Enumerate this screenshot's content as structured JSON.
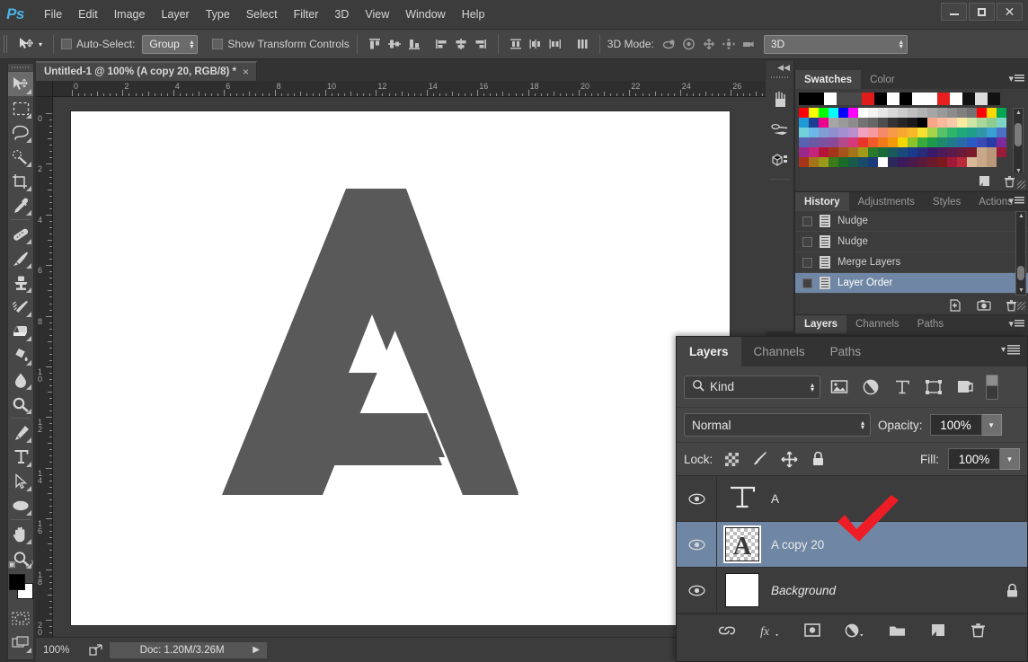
{
  "app": {
    "logo": "Ps",
    "menus": [
      "File",
      "Edit",
      "Image",
      "Layer",
      "Type",
      "Select",
      "Filter",
      "3D",
      "View",
      "Window",
      "Help"
    ],
    "window_controls": {
      "minimize": "minimize-icon",
      "maximize": "maximize-icon",
      "close": "close-icon"
    }
  },
  "options_bar": {
    "tool_icon": "move-tool-icon",
    "autoselect_label": "Auto-Select:",
    "autoselect_checked": false,
    "autoselect_value": "Group",
    "show_transform_label": "Show Transform Controls",
    "show_transform_checked": false,
    "align_icons": [
      "align-top-edges-icon",
      "align-vertical-centers-icon",
      "align-bottom-edges-icon",
      "align-left-edges-icon",
      "align-horizontal-centers-icon",
      "align-right-edges-icon"
    ],
    "distribute_icons": [
      "distribute-top-edges-icon",
      "distribute-vertical-centers-icon",
      "distribute-bottom-edges-icon",
      "distribute-left-edges-icon",
      "distribute-horizontal-centers-icon",
      "distribute-right-edges-icon"
    ],
    "auto_align_icon": "auto-align-layers-icon",
    "mode3d_label": "3D Mode:",
    "mode3d_icons": [
      "rotate-3d-icon",
      "roll-3d-icon",
      "pan-3d-icon",
      "slide-3d-icon",
      "scale-3d-icon"
    ],
    "mode3d_value": "3D"
  },
  "toolbar": {
    "tools": [
      {
        "name": "move-tool",
        "glyph": "move",
        "active": true
      },
      {
        "name": "rectangular-marquee-tool",
        "glyph": "marquee"
      },
      {
        "name": "lasso-tool",
        "glyph": "lasso"
      },
      {
        "name": "quick-selection-tool",
        "glyph": "quickselect"
      },
      {
        "name": "crop-tool",
        "glyph": "crop"
      },
      {
        "name": "eyedropper-tool",
        "glyph": "eyedropper"
      },
      {
        "name": "spot-healing-brush-tool",
        "glyph": "healing"
      },
      {
        "name": "brush-tool",
        "glyph": "brush"
      },
      {
        "name": "clone-stamp-tool",
        "glyph": "stamp"
      },
      {
        "name": "history-brush-tool",
        "glyph": "historybrush"
      },
      {
        "name": "eraser-tool",
        "glyph": "eraser"
      },
      {
        "name": "gradient-tool",
        "glyph": "paintbucket"
      },
      {
        "name": "blur-tool",
        "glyph": "blur"
      },
      {
        "name": "dodge-tool",
        "glyph": "dodge"
      },
      {
        "name": "pen-tool",
        "glyph": "pen"
      },
      {
        "name": "horizontal-type-tool",
        "glyph": "type"
      },
      {
        "name": "path-selection-tool",
        "glyph": "pathselect"
      },
      {
        "name": "ellipse-tool",
        "glyph": "ellipse"
      },
      {
        "name": "hand-tool",
        "glyph": "hand"
      },
      {
        "name": "zoom-tool",
        "glyph": "zoom"
      }
    ],
    "foreground_color": "#000000",
    "background_color": "#ffffff",
    "quick_mask_icon": "quick-mask-icon",
    "screen_mode_icon": "screen-mode-icon"
  },
  "document": {
    "tab_title": "Untitled-1 @ 100% (A copy 20, RGB/8) *",
    "tab_close": "×",
    "ruler_h_ticks": [
      0,
      2,
      4,
      6,
      8,
      10,
      12,
      14,
      16,
      18,
      20,
      22,
      24,
      26
    ],
    "ruler_v_ticks": [
      0,
      2,
      4,
      6,
      8,
      10,
      12,
      14,
      16,
      18,
      20
    ],
    "canvas_background": "#ffffff",
    "artwork_letter": "A",
    "artwork_color": "#595959"
  },
  "status_bar": {
    "zoom": "100%",
    "share_icon": "share-icon",
    "doc_size": "Doc: 1.20M/3.26M",
    "expand_arrow": "▶"
  },
  "dock_strip": {
    "collapse_icon": "collapse-dock-icon",
    "icons": [
      "brush-panel-icon",
      "mixer-brush-panel-icon",
      "3d-panel-icon"
    ]
  },
  "swatches_panel": {
    "tabs": [
      {
        "label": "Swatches",
        "active": true
      },
      {
        "label": "Color",
        "active": false
      }
    ],
    "menu_icon": "panel-menu-icon",
    "recent_colors": [
      "#000000",
      "#000000",
      "#ffffff",
      "#4a4a4a",
      "#4a4a4a",
      "#e01b1b",
      "#000000",
      "#ffffff",
      "#000000",
      "#ffffff",
      "#ffffff",
      "#e81f1f",
      "#ffffff",
      "#111111",
      "#dcdcdc",
      "#111111"
    ],
    "grid_colors": [
      "#ff0000",
      "#ffff00",
      "#00ff00",
      "#00ffff",
      "#0000ff",
      "#ff00ff",
      "#ffffff",
      "#f2f2f2",
      "#e6e6e6",
      "#d9d9d9",
      "#cccccc",
      "#bfbfbf",
      "#b3b3b3",
      "#a6a6a6",
      "#999999",
      "#8c8c8c",
      "#808080",
      "#737373",
      "#ff0000",
      "#ffd700",
      "#00a651",
      "#1e9ad6",
      "#1c3f94",
      "#ec008c",
      "#a6a6a6",
      "#999999",
      "#8c8c8c",
      "#737373",
      "#666666",
      "#4d4d4d",
      "#333333",
      "#262626",
      "#1a1a1a",
      "#000000",
      "#f9a58a",
      "#f9b99a",
      "#fac9aa",
      "#fbeaa2",
      "#cfe3a5",
      "#a9d69a",
      "#8fcb8f",
      "#7fd4c8",
      "#6fd0d9",
      "#6ab7e8",
      "#7f9fd4",
      "#8f8fd0",
      "#a48fd0",
      "#b98fd0",
      "#f2a0c0",
      "#f49aa0",
      "#f58a6a",
      "#f79a4a",
      "#f7a832",
      "#f7b92a",
      "#f7e232",
      "#a8d44a",
      "#59c16a",
      "#2fb56a",
      "#1fa87a",
      "#1f9e8a",
      "#2f97a8",
      "#3aa0d4",
      "#4a6fc4",
      "#5a62b4",
      "#6a5aa4",
      "#7a52a0",
      "#8a4a9a",
      "#b44a8a",
      "#d43a7a",
      "#e8352a",
      "#f05a2a",
      "#f27a1a",
      "#f29a0a",
      "#f2d800",
      "#8ac42a",
      "#3aaa3a",
      "#1f9a4a",
      "#1f8a6a",
      "#1f7a8a",
      "#2a6aa8",
      "#2a5ac4",
      "#3a4ab4",
      "#2a3aa4",
      "#7a2a9a",
      "#9a2a8a",
      "#c4247a",
      "#b4143a",
      "#a4341a",
      "#a4541a",
      "#a4741a",
      "#a49a1a",
      "#2a7a2a",
      "#1a6a3a",
      "#1a5a5a",
      "#1a4a7a",
      "#1a3a8a",
      "#2a2a7a",
      "#3a1a6a",
      "#4a1a5a",
      "#5a1a4a",
      "#6a1a3a",
      "#7a1a2a",
      "#c8a888",
      "#b89878",
      "#9a1a3a",
      "#a4341a",
      "#a4741a",
      "#9a9a1a",
      "#3a7a1a",
      "#1a6a2a",
      "#1a5a4a",
      "#1a4a6a",
      "#1a3a7a",
      "#ffffff",
      "#2a2a5a",
      "#3a1a5a",
      "#4a1a4a",
      "#5a1a3a",
      "#6a1a2a",
      "#7a1a1a",
      "#a01a3a",
      "#b82a3a",
      "#d8b898",
      "#c8a888",
      "#b89878"
    ],
    "footer_icons": [
      "new-swatch-icon",
      "delete-swatch-icon"
    ]
  },
  "history_panel": {
    "tabs": [
      {
        "label": "History",
        "active": true
      },
      {
        "label": "Adjustments",
        "active": false
      },
      {
        "label": "Styles",
        "active": false
      },
      {
        "label": "Actions",
        "active": false
      }
    ],
    "menu_icon": "panel-menu-icon",
    "items": [
      {
        "label": "Nudge",
        "selected": false
      },
      {
        "label": "Nudge",
        "selected": false
      },
      {
        "label": "Merge Layers",
        "selected": false
      },
      {
        "label": "Layer Order",
        "selected": true
      }
    ],
    "footer_icons": [
      "new-document-from-state-icon",
      "new-snapshot-icon",
      "delete-state-icon"
    ],
    "docked_tabs": [
      {
        "label": "Layers",
        "active": true
      },
      {
        "label": "Channels",
        "active": false
      },
      {
        "label": "Paths",
        "active": false
      }
    ]
  },
  "layers_panel": {
    "tabs": [
      {
        "label": "Layers",
        "active": true
      },
      {
        "label": "Channels",
        "active": false
      },
      {
        "label": "Paths",
        "active": false
      }
    ],
    "menu_icon": "panel-menu-icon",
    "filter_kind_label": "Kind",
    "filter_icons": [
      "filter-pixel-layers-icon",
      "filter-adjustment-layers-icon",
      "filter-type-layers-icon",
      "filter-shape-layers-icon",
      "filter-smart-object-layers-icon"
    ],
    "filter_toggle": "filter-enable-toggle",
    "blend_mode": "Normal",
    "opacity_label": "Opacity:",
    "opacity_value": "100%",
    "lock_label": "Lock:",
    "lock_icons": [
      "lock-transparent-pixels-icon",
      "lock-image-pixels-icon",
      "lock-position-icon",
      "lock-all-icon"
    ],
    "fill_label": "Fill:",
    "fill_value": "100%",
    "layers": [
      {
        "name": "A",
        "thumb": "type",
        "visible": true,
        "selected": false,
        "locked": false,
        "italic": false
      },
      {
        "name": "A copy 20",
        "thumb": "checker-a",
        "visible": true,
        "selected": true,
        "locked": false,
        "italic": false
      },
      {
        "name": "Background",
        "thumb": "white",
        "visible": true,
        "selected": false,
        "locked": true,
        "italic": true
      }
    ],
    "footer_icons": [
      "link-layers-icon",
      "layer-style-icon",
      "add-layer-mask-icon",
      "new-fill-adjustment-layer-icon",
      "new-group-icon",
      "new-layer-icon",
      "delete-layer-icon"
    ]
  },
  "annotation": {
    "checkmark_color": "#ee1c25",
    "name": "red-checkmark-annotation"
  }
}
